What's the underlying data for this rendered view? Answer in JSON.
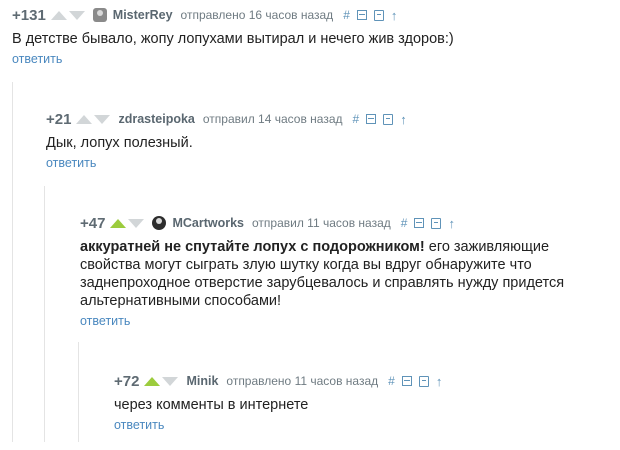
{
  "colors": {
    "rating": "#5f6b73",
    "vote_active": "#9ccc3d",
    "vote_inactive": "#d2d6d8",
    "link": "#4a88bf",
    "tool": "#5f93b8",
    "rail": "#e4e4e4"
  },
  "icons": {
    "hash": "#",
    "arrow": "↑"
  },
  "comments": [
    {
      "rating": "+131",
      "author": "MisterRey",
      "meta": "отправлено 16 часов назад",
      "text": "В детстве бывало, жопу лопухами вытирал и нечего жив здоров:)",
      "reply": "ответить"
    },
    {
      "rating": "+21",
      "author": "zdrasteipoka",
      "meta": "отправил 14 часов назад",
      "text": "Дык, лопух полезный.",
      "reply": "ответить"
    },
    {
      "rating": "+47",
      "author": "MCartworks",
      "meta": "отправил 11 часов назад",
      "text_bold": "аккуратней не спутайте лопух с подорожником!",
      "text": " его заживляющие свойства могут сыграть злую шутку когда вы вдруг обнаружите что заднепроходное отверстие зарубцевалось и справлять нужду придется альтернативными способами!",
      "reply": "ответить"
    },
    {
      "rating": "+72",
      "author": "Minik",
      "meta": "отправлено 11 часов назад",
      "text": "через комменты в интернете",
      "reply": "ответить"
    }
  ]
}
